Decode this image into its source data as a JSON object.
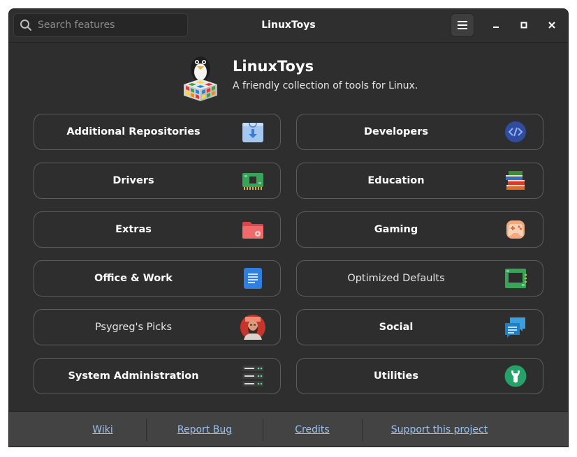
{
  "window": {
    "title": "LinuxToys"
  },
  "search": {
    "placeholder": "Search features",
    "value": ""
  },
  "header_buttons": [
    "hamburger-menu",
    "minimize",
    "maximize",
    "close"
  ],
  "hero": {
    "title": "LinuxToys",
    "subtitle": "A friendly collection of tools for Linux."
  },
  "categories": [
    {
      "label": "Additional Repositories",
      "icon": "repository-bag-icon"
    },
    {
      "label": "Developers",
      "icon": "code-icon"
    },
    {
      "label": "Drivers",
      "icon": "circuit-board-icon"
    },
    {
      "label": "Education",
      "icon": "books-icon"
    },
    {
      "label": "Extras",
      "icon": "folder-gear-icon"
    },
    {
      "label": "Gaming",
      "icon": "gamepad-icon"
    },
    {
      "label": "Office & Work",
      "icon": "document-icon"
    },
    {
      "label": "Optimized Defaults",
      "icon": "chip-icon"
    },
    {
      "label": "Psygreg's Picks",
      "icon": "bearded-avatar-icon"
    },
    {
      "label": "Social",
      "icon": "chat-bubbles-icon"
    },
    {
      "label": "System Administration",
      "icon": "server-rack-icon"
    },
    {
      "label": "Utilities",
      "icon": "hand-tool-icon"
    }
  ],
  "footer": {
    "links": [
      "Wiki",
      "Report Bug",
      "Credits",
      "Support this project"
    ]
  },
  "colors": {
    "background": "#2e2e2e",
    "card_border": "#5d5d5d",
    "link": "#99c1f1",
    "footer_bg": "#434343"
  }
}
